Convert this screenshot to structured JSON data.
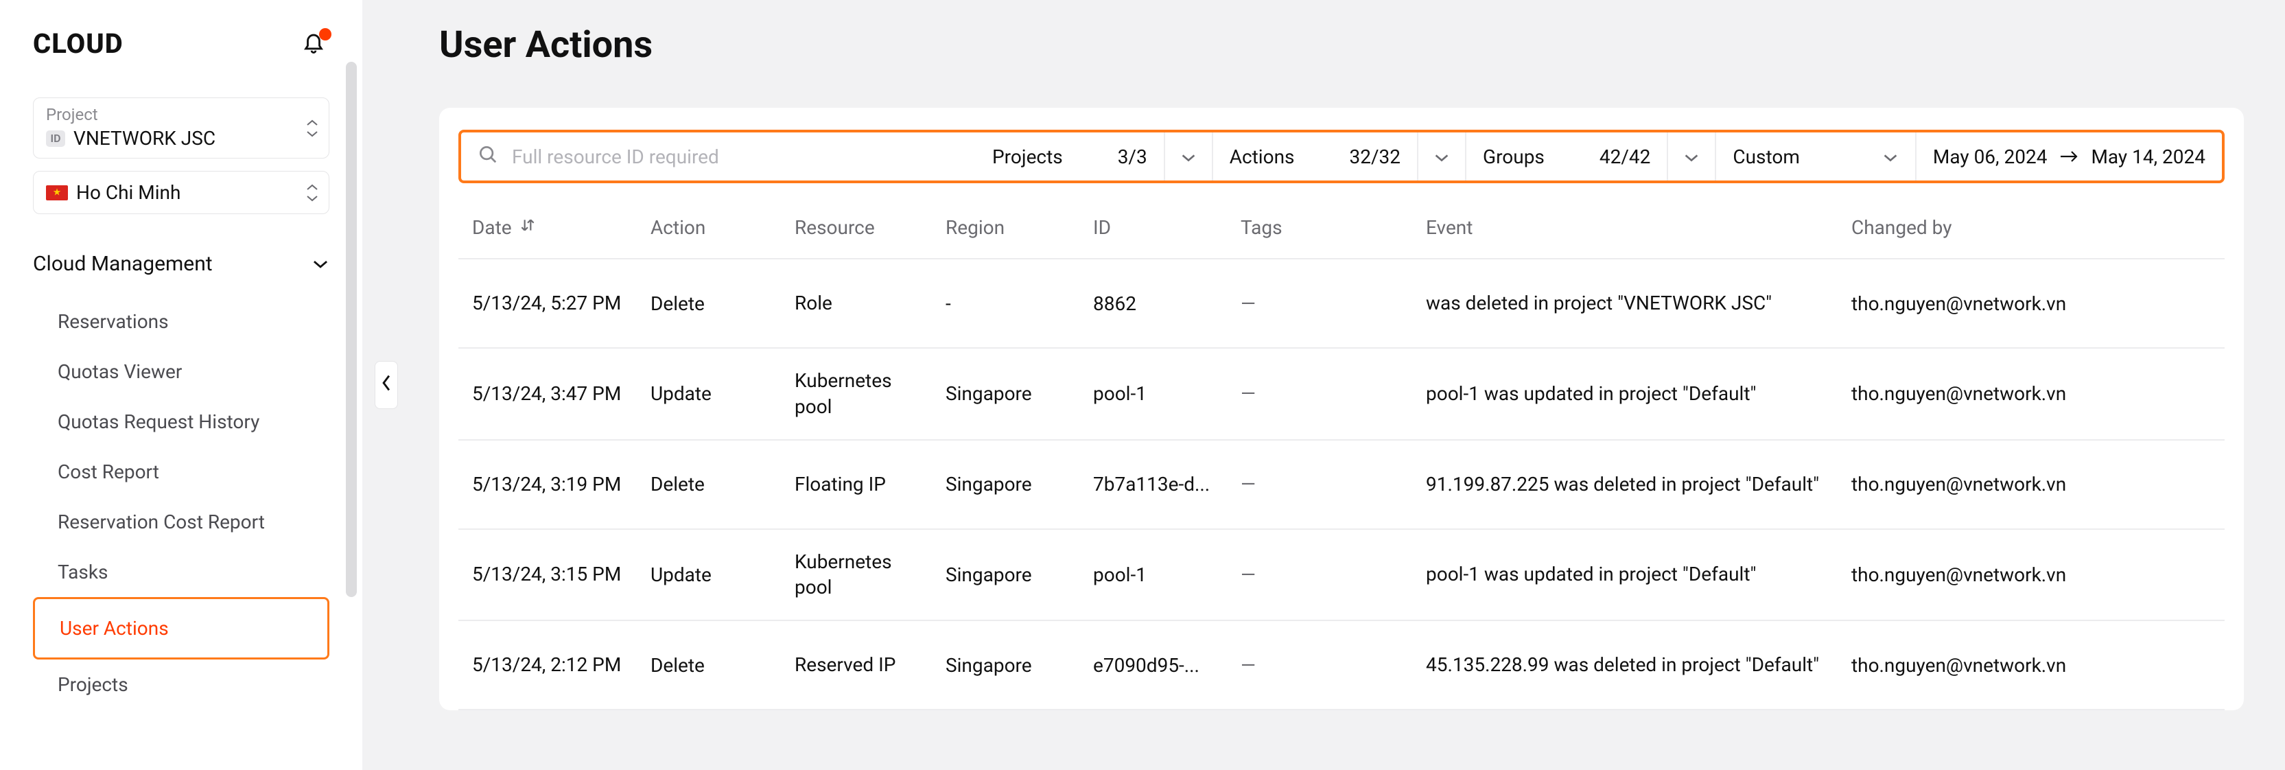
{
  "brand": "CLOUD",
  "sidebar": {
    "project_label": "Project",
    "project_value": "VNETWORK JSC",
    "region_value": "Ho Chi Minh",
    "section_label": "Cloud Management",
    "items": [
      {
        "label": "Reservations"
      },
      {
        "label": "Quotas Viewer"
      },
      {
        "label": "Quotas Request History"
      },
      {
        "label": "Cost Report"
      },
      {
        "label": "Reservation Cost Report"
      },
      {
        "label": "Tasks"
      },
      {
        "label": "User Actions"
      },
      {
        "label": "Projects"
      }
    ]
  },
  "page": {
    "title": "User Actions"
  },
  "filters": {
    "search_placeholder": "Full resource ID required",
    "projects_label": "Projects",
    "projects_count": "3/3",
    "actions_label": "Actions",
    "actions_count": "32/32",
    "groups_label": "Groups",
    "groups_count": "42/42",
    "range_label": "Custom",
    "date_from": "May 06, 2024",
    "date_to": "May 14, 2024"
  },
  "table": {
    "headers": {
      "date": "Date",
      "action": "Action",
      "resource": "Resource",
      "region": "Region",
      "id": "ID",
      "tags": "Tags",
      "event": "Event",
      "changed_by": "Changed by"
    },
    "rows": [
      {
        "date": "5/13/24, 5:27 PM",
        "action": "Delete",
        "resource": "Role",
        "region": "-",
        "id": "8862",
        "tags": "—",
        "event": "was deleted in project \"VNETWORK JSC\"",
        "changed_by": "tho.nguyen@vnetwork.vn"
      },
      {
        "date": "5/13/24, 3:47 PM",
        "action": "Update",
        "resource": "Kubernetes pool",
        "region": "Singapore",
        "id": "pool-1",
        "tags": "—",
        "event": "pool-1 was updated in project \"Default\"",
        "changed_by": "tho.nguyen@vnetwork.vn"
      },
      {
        "date": "5/13/24, 3:19 PM",
        "action": "Delete",
        "resource": "Floating IP",
        "region": "Singapore",
        "id": "7b7a113e-d...",
        "tags": "—",
        "event": "91.199.87.225 was deleted in project \"Default\"",
        "changed_by": "tho.nguyen@vnetwork.vn"
      },
      {
        "date": "5/13/24, 3:15 PM",
        "action": "Update",
        "resource": "Kubernetes pool",
        "region": "Singapore",
        "id": "pool-1",
        "tags": "—",
        "event": "pool-1 was updated in project \"Default\"",
        "changed_by": "tho.nguyen@vnetwork.vn"
      },
      {
        "date": "5/13/24, 2:12 PM",
        "action": "Delete",
        "resource": "Reserved IP",
        "region": "Singapore",
        "id": "e7090d95-...",
        "tags": "—",
        "event": "45.135.228.99 was deleted in project \"Default\"",
        "changed_by": "tho.nguyen@vnetwork.vn"
      }
    ]
  }
}
